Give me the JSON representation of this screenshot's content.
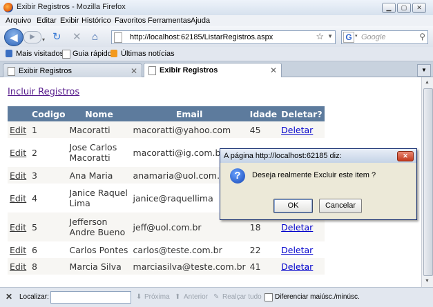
{
  "window": {
    "title": "Exibir Registros - Mozilla Firefox"
  },
  "menu": [
    "Arquivo",
    "Editar",
    "Exibir",
    "Histórico",
    "Favoritos",
    "Ferramentas",
    "Ajuda"
  ],
  "nav": {
    "url": "http://localhost:62185/ListarRegistros.aspx",
    "search_placeholder": "Google"
  },
  "bookmarks": [
    "Mais visitados",
    "Guia rápido",
    "Últimas notícias"
  ],
  "tabs": [
    {
      "label": "Exibir Registros"
    },
    {
      "label": "Exibir Registros"
    }
  ],
  "page": {
    "incluir_link": "Incluir Registros",
    "columns": [
      "Codigo",
      "Nome",
      "Email",
      "Idade",
      "Deletar?"
    ],
    "rows": [
      {
        "edit": "Edit",
        "codigo": "1",
        "nome": "Macoratti",
        "email": "macoratti@yahoo.com",
        "idade": "45",
        "deletar": "Deletar"
      },
      {
        "edit": "Edit",
        "codigo": "2",
        "nome": "Jose Carlos Macoratti",
        "email": "macoratti@ig.com.br",
        "idade": "",
        "deletar": ""
      },
      {
        "edit": "Edit",
        "codigo": "3",
        "nome": "Ana Maria",
        "email": "anamaria@uol.com.br",
        "idade": "",
        "deletar": ""
      },
      {
        "edit": "Edit",
        "codigo": "4",
        "nome": "Janice Raquel Lima",
        "email": "janice@raquellima",
        "idade": "",
        "deletar": ""
      },
      {
        "edit": "Edit",
        "codigo": "5",
        "nome": "Jefferson Andre Bueno",
        "email": "jeff@uol.com.br",
        "idade": "18",
        "deletar": "Deletar"
      },
      {
        "edit": "Edit",
        "codigo": "6",
        "nome": "Carlos Pontes",
        "email": "carlos@teste.com.br",
        "idade": "22",
        "deletar": "Deletar"
      },
      {
        "edit": "Edit",
        "codigo": "8",
        "nome": "Marcia Silva",
        "email": "marciasilva@teste.com.br",
        "idade": "41",
        "deletar": "Deletar"
      }
    ]
  },
  "dialog": {
    "title": "A página http://localhost:62185 diz:",
    "message": "Deseja realmente Excluir este item ?",
    "ok": "OK",
    "cancel": "Cancelar"
  },
  "findbar": {
    "label": "Localizar:",
    "next": "Próxima",
    "previous": "Anterior",
    "highlight": "Realçar tudo",
    "match_case": "Diferenciar maiúsc./minúsc."
  },
  "colors": {
    "grid_header": "#5d7b9d",
    "link": "#0000cc",
    "visited_link": "#551a8b"
  }
}
